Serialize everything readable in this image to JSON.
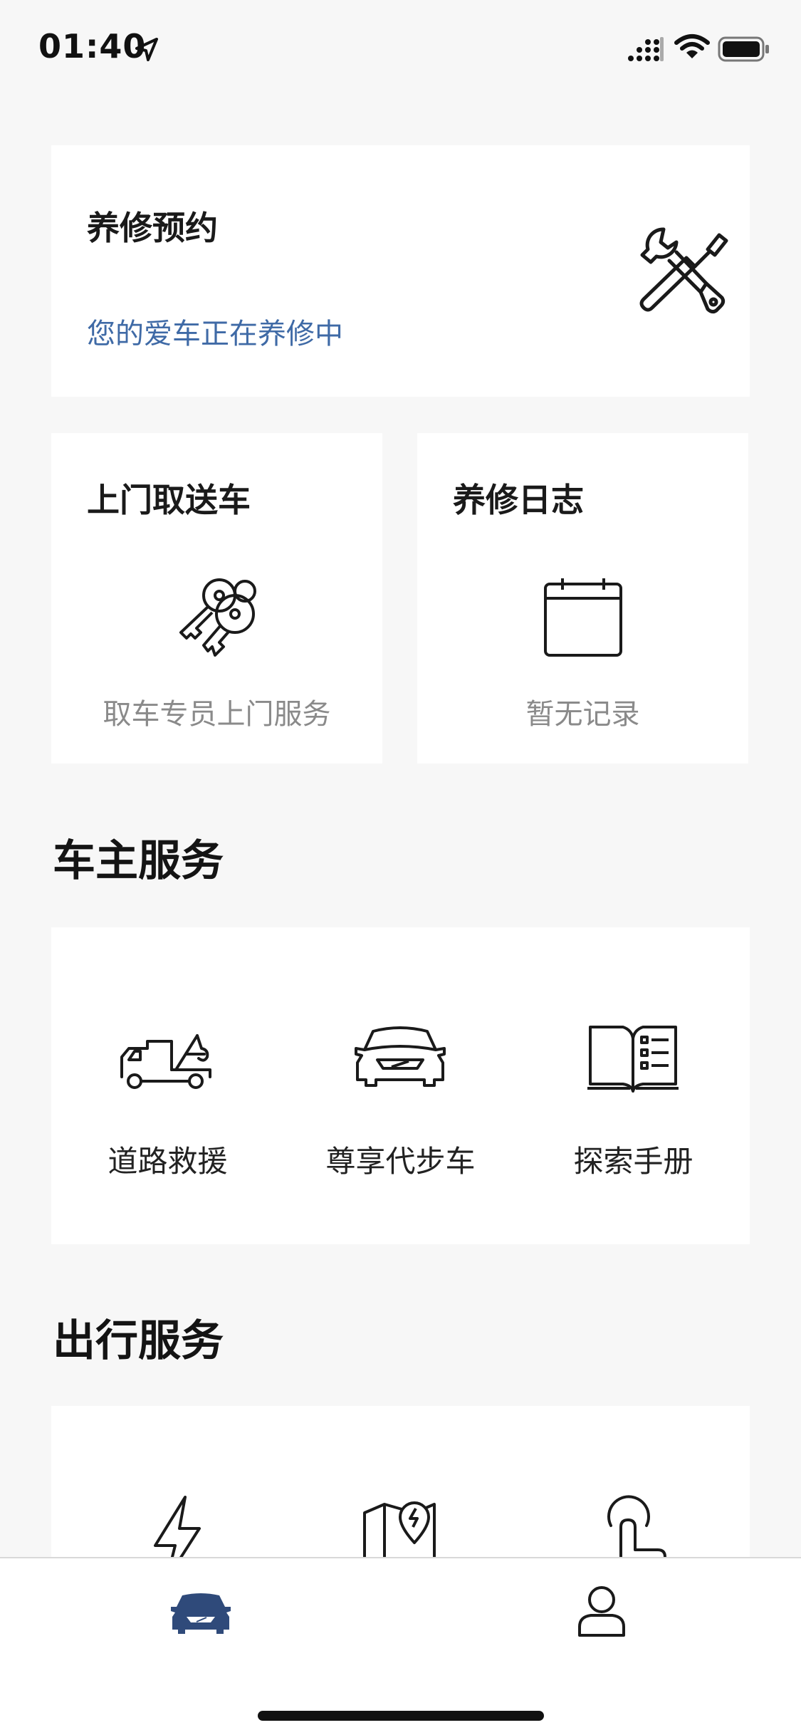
{
  "status_bar": {
    "time": "01:40",
    "icons": [
      "location-arrow-icon",
      "signal-icon",
      "wifi-icon",
      "battery-icon"
    ]
  },
  "maintenance": {
    "title": "养修预约",
    "status": "您的爱车正在养修中",
    "icon": "tools-icon",
    "status_color": "#3f6aa6"
  },
  "pickup": {
    "title": "上门取送车",
    "subtitle": "取车专员上门服务",
    "icon": "keys-icon"
  },
  "log": {
    "title": "养修日志",
    "subtitle": "暂无记录",
    "icon": "calendar-icon"
  },
  "owner_services": {
    "title": "车主服务",
    "items": [
      {
        "label": "道路救援",
        "icon": "tow-truck-icon"
      },
      {
        "label": "尊享代步车",
        "icon": "car-front-icon"
      },
      {
        "label": "探索手册",
        "icon": "manual-book-icon"
      }
    ]
  },
  "travel_services": {
    "title": "出行服务",
    "items": [
      {
        "icon": "lightning-icon"
      },
      {
        "icon": "map-charging-icon"
      },
      {
        "icon": "touch-hand-icon"
      }
    ]
  },
  "tab_bar": {
    "tabs": [
      {
        "icon": "car-tab-icon",
        "active": true
      },
      {
        "icon": "profile-tab-icon",
        "active": false
      }
    ],
    "active_color": "#2f4a7a"
  }
}
